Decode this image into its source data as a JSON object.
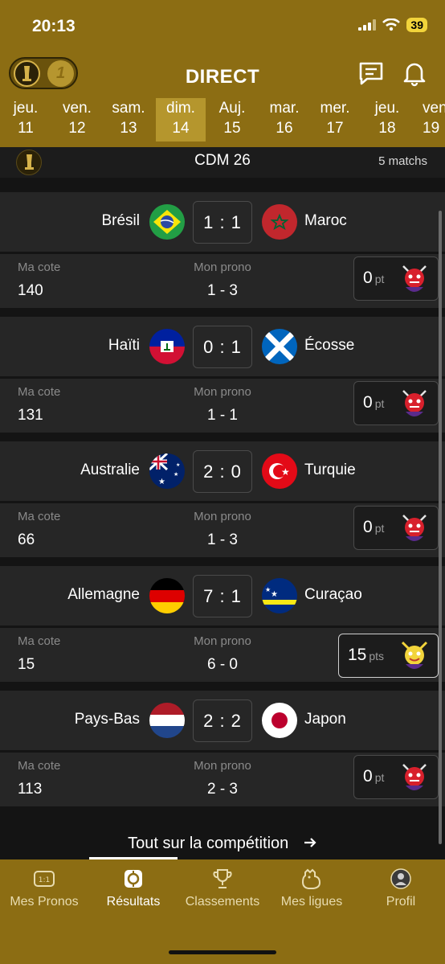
{
  "status": {
    "time": "20:13",
    "battery": "39"
  },
  "header": {
    "title": "DIRECT"
  },
  "days": [
    {
      "dow": "jeu.",
      "num": "11"
    },
    {
      "dow": "ven.",
      "num": "12"
    },
    {
      "dow": "sam.",
      "num": "13"
    },
    {
      "dow": "dim.",
      "num": "14"
    },
    {
      "dow": "Auj.",
      "num": "15"
    },
    {
      "dow": "mar.",
      "num": "16"
    },
    {
      "dow": "mer.",
      "num": "17"
    },
    {
      "dow": "jeu.",
      "num": "18"
    },
    {
      "dow": "ven",
      "num": "19"
    }
  ],
  "competition": {
    "name": "CDM 26",
    "count": "5 matchs"
  },
  "labels": {
    "cote": "Ma cote",
    "prono": "Mon prono"
  },
  "matches": [
    {
      "home": "Brésil",
      "away": "Maroc",
      "score": "1 : 1",
      "cote": "140",
      "prono": "1 - 3",
      "pts": "0",
      "unit": "pt"
    },
    {
      "home": "Haïti",
      "away": "Écosse",
      "score": "0 : 1",
      "cote": "131",
      "prono": "1 - 1",
      "pts": "0",
      "unit": "pt"
    },
    {
      "home": "Australie",
      "away": "Turquie",
      "score": "2 : 0",
      "cote": "66",
      "prono": "1 - 3",
      "pts": "0",
      "unit": "pt"
    },
    {
      "home": "Allemagne",
      "away": "Curaçao",
      "score": "7 : 1",
      "cote": "15",
      "prono": "6 - 0",
      "pts": "15",
      "unit": "pts"
    },
    {
      "home": "Pays-Bas",
      "away": "Japon",
      "score": "2 : 2",
      "cote": "113",
      "prono": "2 - 3",
      "pts": "0",
      "unit": "pt"
    }
  ],
  "footer": {
    "link": "Tout sur la compétition"
  },
  "tabs": [
    {
      "label": "Mes Pronos",
      "icon": "scoreboard-icon"
    },
    {
      "label": "Résultats",
      "icon": "ball-icon"
    },
    {
      "label": "Classements",
      "icon": "trophy-icon"
    },
    {
      "label": "Mes ligues",
      "icon": "rooster-icon"
    },
    {
      "label": "Profil",
      "icon": "avatar-icon"
    }
  ],
  "colors": {
    "header": "#8c6d13",
    "active_day": "#b5962d",
    "card": "#262626",
    "background": "#1c1c1c"
  }
}
